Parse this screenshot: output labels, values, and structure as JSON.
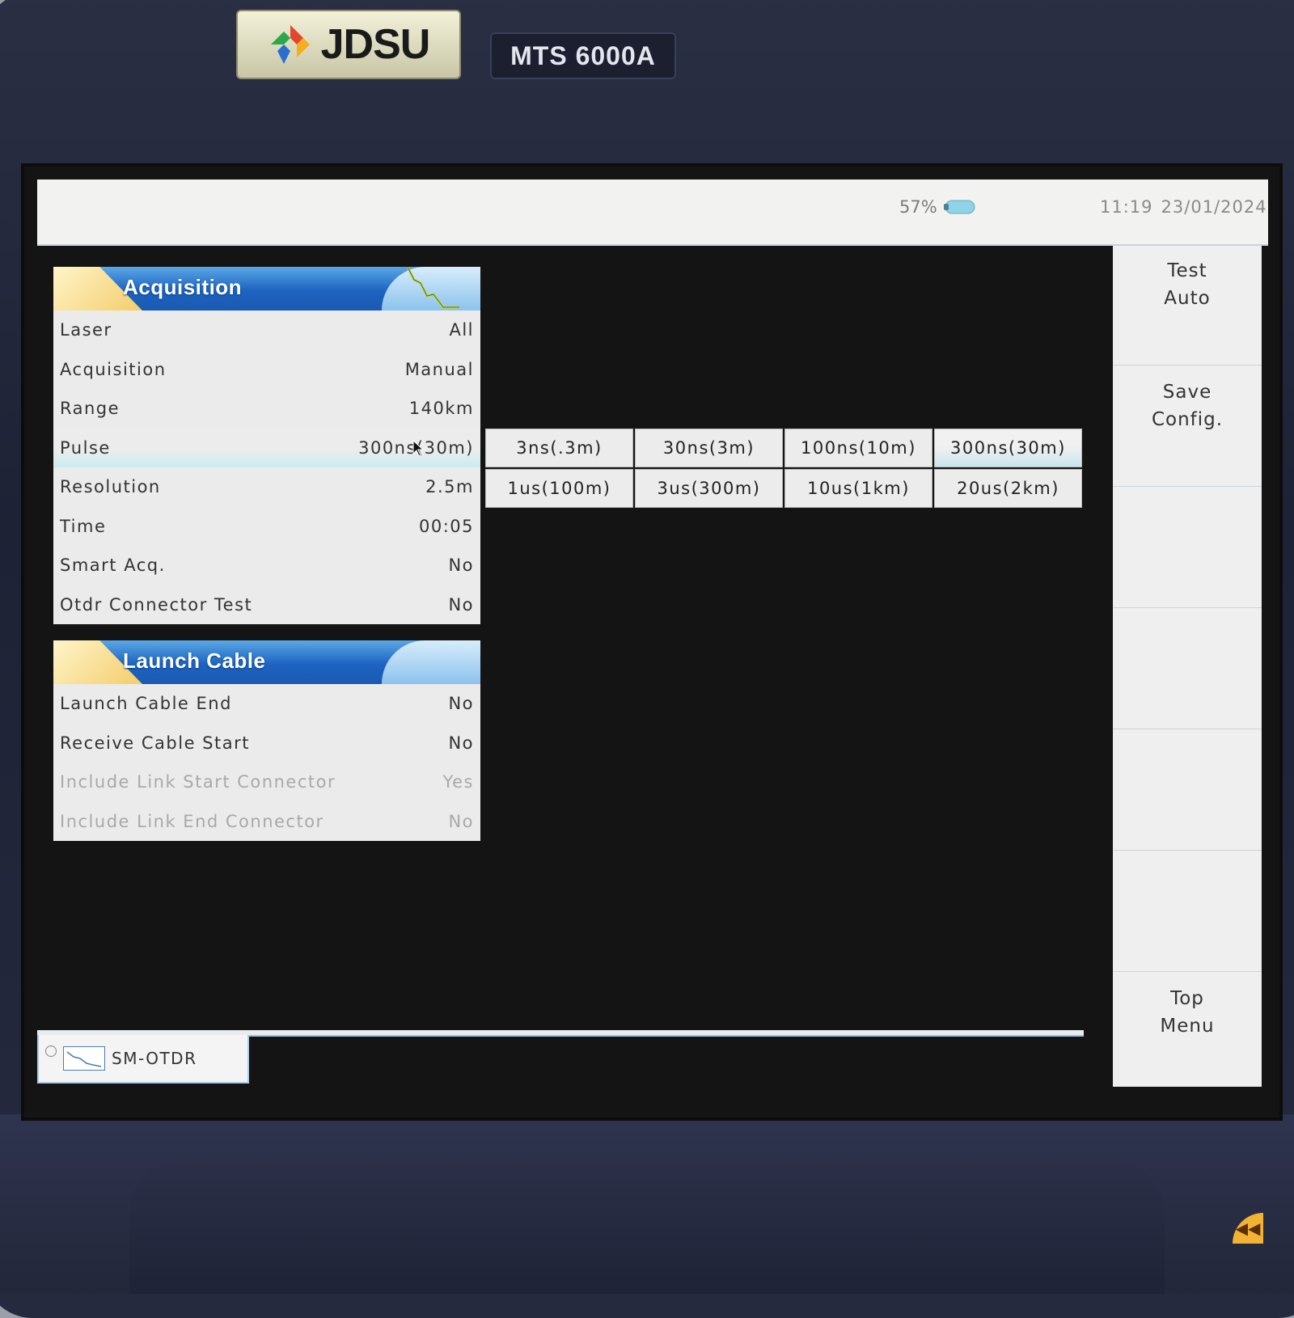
{
  "device": {
    "brand": "JDSU",
    "model": "MTS 6000A"
  },
  "status_bar": {
    "battery": "57%",
    "time": "11:19",
    "date": "23/01/2024"
  },
  "acquisition_panel": {
    "title": "Acquisition",
    "rows": [
      {
        "label": "Laser",
        "value": "All"
      },
      {
        "label": "Acquisition",
        "value": "Manual"
      },
      {
        "label": "Range",
        "value": "140km"
      },
      {
        "label": "Pulse",
        "value": "300ns(30m)"
      },
      {
        "label": "Resolution",
        "value": "2.5m"
      },
      {
        "label": "Time",
        "value": "00:05"
      },
      {
        "label": "Smart Acq.",
        "value": "No"
      },
      {
        "label": "Otdr Connector Test",
        "value": "No"
      }
    ]
  },
  "launch_cable_panel": {
    "title": "Launch Cable",
    "rows": [
      {
        "label": "Launch Cable End",
        "value": "No"
      },
      {
        "label": "Receive Cable Start",
        "value": "No"
      },
      {
        "label": "Include Link Start Connector",
        "value": "Yes"
      },
      {
        "label": "Include Link End Connector",
        "value": "No"
      }
    ]
  },
  "pulse_options": [
    "3ns(.3m)",
    "30ns(3m)",
    "100ns(10m)",
    "300ns(30m)",
    "1us(100m)",
    "3us(300m)",
    "10us(1km)",
    "20us(2km)"
  ],
  "side_menu": {
    "test_auto": [
      "Test",
      "Auto"
    ],
    "save_config": [
      "Save",
      "Config."
    ],
    "top_menu": [
      "Top",
      "Menu"
    ]
  },
  "bottom_tab": {
    "label": "SM-OTDR"
  },
  "colors": {
    "header_blue": "#1d63c0",
    "header_wedge": "#f3cd6a",
    "selection_tint": "#c9ecef",
    "screen_bg": "#141414"
  }
}
